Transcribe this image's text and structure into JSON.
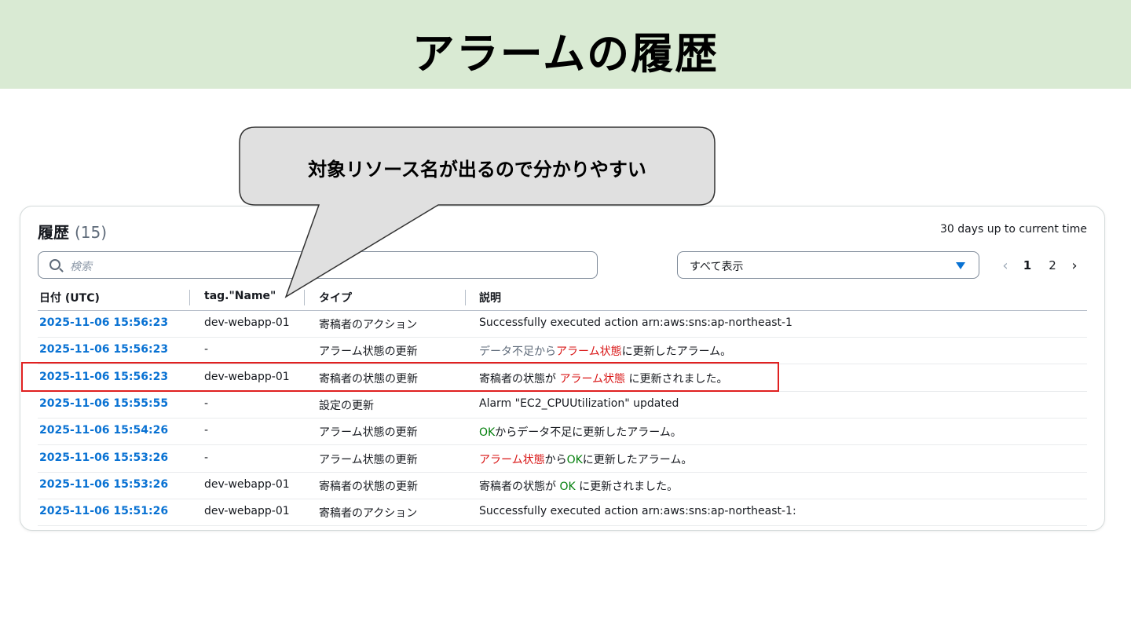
{
  "slide": {
    "title": "アラームの履歴"
  },
  "callout": {
    "text": "対象リソース名が出るので分かりやすい"
  },
  "history": {
    "title": "履歴",
    "count": "(15)",
    "range": "30 days up to current time",
    "search": {
      "placeholder": "検索"
    },
    "filter": {
      "selected": "すべて表示"
    },
    "pagination": {
      "current": "1",
      "next_page": "2"
    },
    "columns": [
      "日付 (UTC)",
      "tag.\"Name\"",
      "タイプ",
      "説明"
    ],
    "rows": [
      {
        "date": "2025-11-06 15:56:23",
        "name": "dev-webapp-01",
        "type": "寄稿者のアクション",
        "desc": [
          {
            "text": "Successfully executed action arn:aws:sns:ap-northeast-1",
            "style": "normal"
          }
        ]
      },
      {
        "date": "2025-11-06 15:56:23",
        "name": "-",
        "type": "アラーム状態の更新",
        "desc": [
          {
            "text": "データ不足から",
            "style": "muted"
          },
          {
            "text": "アラーム状態",
            "style": "alarm"
          },
          {
            "text": "に更新したアラーム。",
            "style": "normal"
          }
        ]
      },
      {
        "date": "2025-11-06 15:56:23",
        "name": "dev-webapp-01",
        "type": "寄稿者の状態の更新",
        "desc": [
          {
            "text": "寄稿者の状態が ",
            "style": "normal"
          },
          {
            "text": "アラーム状態",
            "style": "alarm"
          },
          {
            "text": " に更新されました。",
            "style": "normal"
          }
        ]
      },
      {
        "date": "2025-11-06 15:55:55",
        "name": "-",
        "type": "設定の更新",
        "desc": [
          {
            "text": "Alarm \"EC2_CPUUtilization\" updated",
            "style": "normal"
          }
        ]
      },
      {
        "date": "2025-11-06 15:54:26",
        "name": "-",
        "type": "アラーム状態の更新",
        "desc": [
          {
            "text": "OK",
            "style": "ok"
          },
          {
            "text": "からデータ不足に更新したアラーム。",
            "style": "normal"
          }
        ]
      },
      {
        "date": "2025-11-06 15:53:26",
        "name": "-",
        "type": "アラーム状態の更新",
        "desc": [
          {
            "text": "アラーム状態",
            "style": "alarm"
          },
          {
            "text": "から",
            "style": "normal"
          },
          {
            "text": "OK",
            "style": "ok"
          },
          {
            "text": "に更新したアラーム。",
            "style": "normal"
          }
        ]
      },
      {
        "date": "2025-11-06 15:53:26",
        "name": "dev-webapp-01",
        "type": "寄稿者の状態の更新",
        "desc": [
          {
            "text": "寄稿者の状態が ",
            "style": "normal"
          },
          {
            "text": "OK",
            "style": "ok"
          },
          {
            "text": " に更新されました。",
            "style": "normal"
          }
        ]
      },
      {
        "date": "2025-11-06 15:51:26",
        "name": "dev-webapp-01",
        "type": "寄稿者のアクション",
        "desc": [
          {
            "text": "Successfully executed action arn:aws:sns:ap-northeast-1:",
            "style": "normal"
          }
        ]
      }
    ]
  },
  "colors": {
    "accent": "#0972d3",
    "alarm": "#d91515",
    "ok": "#037f0c",
    "banner": "#d9ead3",
    "highlight": "#e02020"
  }
}
